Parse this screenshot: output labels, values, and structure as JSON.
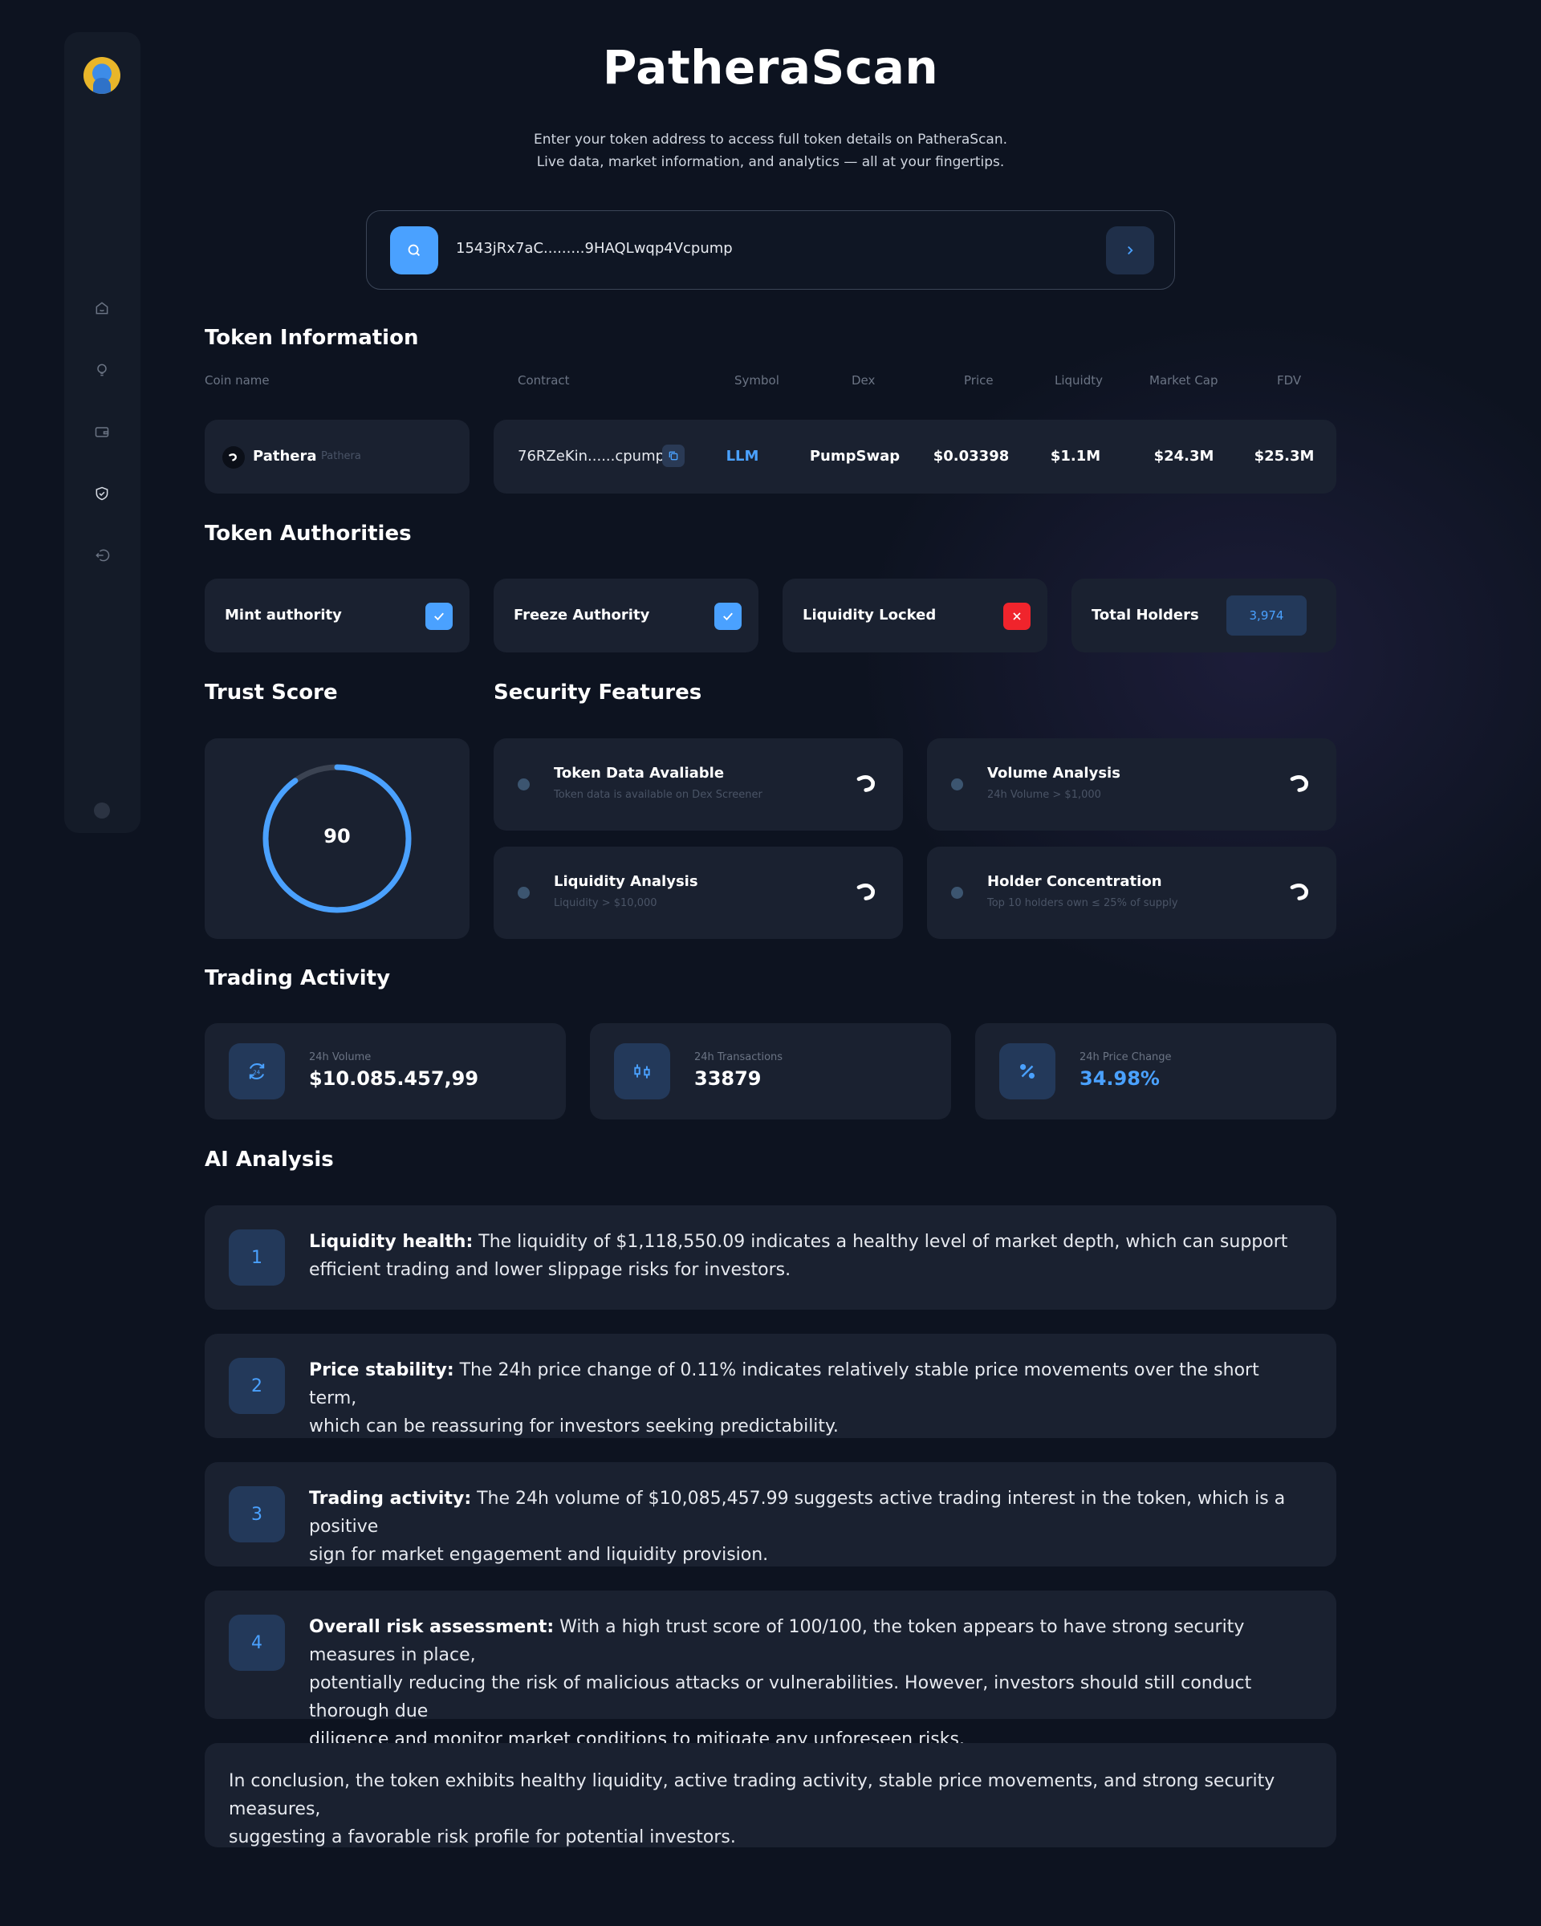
{
  "app": {
    "title": "PatheraScan",
    "subtitle_line1": "Enter your token address to access full token details on PatheraScan.",
    "subtitle_line2": "Live data, market information, and analytics — all at your fingertips."
  },
  "search": {
    "value": "1543jRx7aC.........9HAQLwqp4Vcpump"
  },
  "colors": {
    "accent": "#4aa1ff",
    "danger": "#f0242c",
    "background": "#0d1320",
    "card": "#1a2130"
  },
  "sidebar": {
    "icons": [
      "home-icon",
      "lightbulb-icon",
      "wallet-icon",
      "shield-check-icon",
      "logout-icon"
    ]
  },
  "token_info": {
    "section_title": "Token Information",
    "columns": [
      "Coin name",
      "Contract",
      "Symbol",
      "Dex",
      "Price",
      "Liquidty",
      "Market Cap",
      "FDV"
    ],
    "coin_name": "Pathera",
    "coin_sub": "Pathera",
    "contract": "76RZeKin......cpump",
    "symbol": "LLM",
    "dex": "PumpSwap",
    "price": "$0.03398",
    "liquidity": "$1.1M",
    "market_cap": "$24.3M",
    "fdv": "$25.3M"
  },
  "authorities": {
    "section_title": "Token Authorities",
    "items": [
      {
        "label": "Mint authority",
        "status": "check"
      },
      {
        "label": "Freeze Authority",
        "status": "check"
      },
      {
        "label": "Liquidity Locked",
        "status": "cross"
      }
    ],
    "holders_label": "Total Holders",
    "holders_value": "3,974"
  },
  "trust": {
    "section_title": "Trust Score",
    "value": "90",
    "score_fraction": 0.9
  },
  "security": {
    "section_title": "Security Features",
    "items": [
      {
        "title": "Token Data Avaliable",
        "sub": "Token data is available on Dex Screener"
      },
      {
        "title": "Volume Analysis",
        "sub": "24h Volume > $1,000"
      },
      {
        "title": "Liquidity Analysis",
        "sub": "Liquidity > $10,000"
      },
      {
        "title": "Holder Concentration",
        "sub": "Top 10 holders own ≤ 25% of supply"
      }
    ]
  },
  "trading": {
    "section_title": "Trading Activity",
    "items": [
      {
        "label": "24h Volume",
        "value": "$10.085.457,99",
        "icon": "refresh-24h-icon"
      },
      {
        "label": "24h Transactions",
        "value": "33879",
        "icon": "candlestick-icon"
      },
      {
        "label": "24h Price Change",
        "value": "34.98%",
        "icon": "percent-icon"
      }
    ]
  },
  "ai": {
    "section_title": "AI Analysis",
    "items": [
      {
        "num": "1",
        "bold": "Liquidity health:",
        "line1": " The liquidity of $1,118,550.09 indicates a healthy level of market depth, which can support",
        "line2": "efficient trading and lower slippage risks for investors."
      },
      {
        "num": "2",
        "bold": "Price stability:",
        "line1": " The 24h price change of 0.11% indicates relatively stable price movements over the short term,",
        "line2": "which can be reassuring for investors seeking predictability."
      },
      {
        "num": "3",
        "bold": "Trading activity:",
        "line1": " The 24h volume of $10,085,457.99 suggests active trading interest in the token, which is a positive",
        "line2": "sign for market engagement and liquidity provision."
      },
      {
        "num": "4",
        "bold": "Overall risk assessment:",
        "line1": " With a high trust score of 100/100, the token appears to have strong security measures in place,",
        "line2": "potentially reducing the risk of malicious attacks or vulnerabilities. However, investors should still conduct thorough due",
        "line3": "diligence and monitor market conditions to mitigate any unforeseen risks."
      }
    ],
    "conclusion_line1": "In conclusion, the token exhibits healthy liquidity, active trading activity, stable price movements, and strong security measures,",
    "conclusion_line2": "suggesting a favorable risk profile for potential investors."
  }
}
